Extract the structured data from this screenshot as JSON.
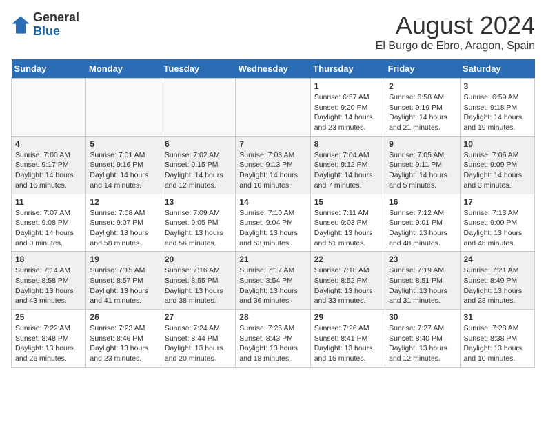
{
  "header": {
    "logo_general": "General",
    "logo_blue": "Blue",
    "month_title": "August 2024",
    "location": "El Burgo de Ebro, Aragon, Spain"
  },
  "weekdays": [
    "Sunday",
    "Monday",
    "Tuesday",
    "Wednesday",
    "Thursday",
    "Friday",
    "Saturday"
  ],
  "weeks": [
    [
      {
        "day": "",
        "info": ""
      },
      {
        "day": "",
        "info": ""
      },
      {
        "day": "",
        "info": ""
      },
      {
        "day": "",
        "info": ""
      },
      {
        "day": "1",
        "info": "Sunrise: 6:57 AM\nSunset: 9:20 PM\nDaylight: 14 hours\nand 23 minutes."
      },
      {
        "day": "2",
        "info": "Sunrise: 6:58 AM\nSunset: 9:19 PM\nDaylight: 14 hours\nand 21 minutes."
      },
      {
        "day": "3",
        "info": "Sunrise: 6:59 AM\nSunset: 9:18 PM\nDaylight: 14 hours\nand 19 minutes."
      }
    ],
    [
      {
        "day": "4",
        "info": "Sunrise: 7:00 AM\nSunset: 9:17 PM\nDaylight: 14 hours\nand 16 minutes."
      },
      {
        "day": "5",
        "info": "Sunrise: 7:01 AM\nSunset: 9:16 PM\nDaylight: 14 hours\nand 14 minutes."
      },
      {
        "day": "6",
        "info": "Sunrise: 7:02 AM\nSunset: 9:15 PM\nDaylight: 14 hours\nand 12 minutes."
      },
      {
        "day": "7",
        "info": "Sunrise: 7:03 AM\nSunset: 9:13 PM\nDaylight: 14 hours\nand 10 minutes."
      },
      {
        "day": "8",
        "info": "Sunrise: 7:04 AM\nSunset: 9:12 PM\nDaylight: 14 hours\nand 7 minutes."
      },
      {
        "day": "9",
        "info": "Sunrise: 7:05 AM\nSunset: 9:11 PM\nDaylight: 14 hours\nand 5 minutes."
      },
      {
        "day": "10",
        "info": "Sunrise: 7:06 AM\nSunset: 9:09 PM\nDaylight: 14 hours\nand 3 minutes."
      }
    ],
    [
      {
        "day": "11",
        "info": "Sunrise: 7:07 AM\nSunset: 9:08 PM\nDaylight: 14 hours\nand 0 minutes."
      },
      {
        "day": "12",
        "info": "Sunrise: 7:08 AM\nSunset: 9:07 PM\nDaylight: 13 hours\nand 58 minutes."
      },
      {
        "day": "13",
        "info": "Sunrise: 7:09 AM\nSunset: 9:05 PM\nDaylight: 13 hours\nand 56 minutes."
      },
      {
        "day": "14",
        "info": "Sunrise: 7:10 AM\nSunset: 9:04 PM\nDaylight: 13 hours\nand 53 minutes."
      },
      {
        "day": "15",
        "info": "Sunrise: 7:11 AM\nSunset: 9:03 PM\nDaylight: 13 hours\nand 51 minutes."
      },
      {
        "day": "16",
        "info": "Sunrise: 7:12 AM\nSunset: 9:01 PM\nDaylight: 13 hours\nand 48 minutes."
      },
      {
        "day": "17",
        "info": "Sunrise: 7:13 AM\nSunset: 9:00 PM\nDaylight: 13 hours\nand 46 minutes."
      }
    ],
    [
      {
        "day": "18",
        "info": "Sunrise: 7:14 AM\nSunset: 8:58 PM\nDaylight: 13 hours\nand 43 minutes."
      },
      {
        "day": "19",
        "info": "Sunrise: 7:15 AM\nSunset: 8:57 PM\nDaylight: 13 hours\nand 41 minutes."
      },
      {
        "day": "20",
        "info": "Sunrise: 7:16 AM\nSunset: 8:55 PM\nDaylight: 13 hours\nand 38 minutes."
      },
      {
        "day": "21",
        "info": "Sunrise: 7:17 AM\nSunset: 8:54 PM\nDaylight: 13 hours\nand 36 minutes."
      },
      {
        "day": "22",
        "info": "Sunrise: 7:18 AM\nSunset: 8:52 PM\nDaylight: 13 hours\nand 33 minutes."
      },
      {
        "day": "23",
        "info": "Sunrise: 7:19 AM\nSunset: 8:51 PM\nDaylight: 13 hours\nand 31 minutes."
      },
      {
        "day": "24",
        "info": "Sunrise: 7:21 AM\nSunset: 8:49 PM\nDaylight: 13 hours\nand 28 minutes."
      }
    ],
    [
      {
        "day": "25",
        "info": "Sunrise: 7:22 AM\nSunset: 8:48 PM\nDaylight: 13 hours\nand 26 minutes."
      },
      {
        "day": "26",
        "info": "Sunrise: 7:23 AM\nSunset: 8:46 PM\nDaylight: 13 hours\nand 23 minutes."
      },
      {
        "day": "27",
        "info": "Sunrise: 7:24 AM\nSunset: 8:44 PM\nDaylight: 13 hours\nand 20 minutes."
      },
      {
        "day": "28",
        "info": "Sunrise: 7:25 AM\nSunset: 8:43 PM\nDaylight: 13 hours\nand 18 minutes."
      },
      {
        "day": "29",
        "info": "Sunrise: 7:26 AM\nSunset: 8:41 PM\nDaylight: 13 hours\nand 15 minutes."
      },
      {
        "day": "30",
        "info": "Sunrise: 7:27 AM\nSunset: 8:40 PM\nDaylight: 13 hours\nand 12 minutes."
      },
      {
        "day": "31",
        "info": "Sunrise: 7:28 AM\nSunset: 8:38 PM\nDaylight: 13 hours\nand 10 minutes."
      }
    ]
  ]
}
